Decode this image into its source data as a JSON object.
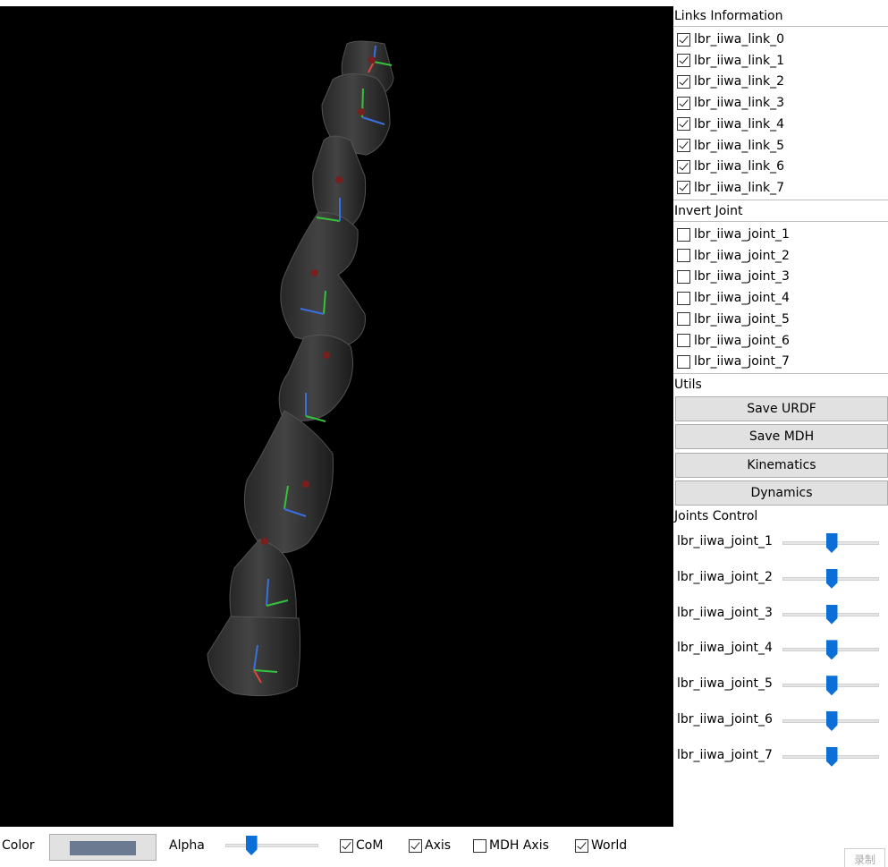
{
  "viewport": {
    "background": "#000000"
  },
  "links_information": {
    "title": "Links Information",
    "items": [
      {
        "label": "lbr_iiwa_link_0",
        "checked": true
      },
      {
        "label": "lbr_iiwa_link_1",
        "checked": true
      },
      {
        "label": "lbr_iiwa_link_2",
        "checked": true
      },
      {
        "label": "lbr_iiwa_link_3",
        "checked": true
      },
      {
        "label": "lbr_iiwa_link_4",
        "checked": true
      },
      {
        "label": "lbr_iiwa_link_5",
        "checked": true
      },
      {
        "label": "lbr_iiwa_link_6",
        "checked": true
      },
      {
        "label": "lbr_iiwa_link_7",
        "checked": true
      }
    ]
  },
  "invert_joint": {
    "title": "Invert Joint",
    "items": [
      {
        "label": "lbr_iiwa_joint_1",
        "checked": false
      },
      {
        "label": "lbr_iiwa_joint_2",
        "checked": false
      },
      {
        "label": "lbr_iiwa_joint_3",
        "checked": false
      },
      {
        "label": "lbr_iiwa_joint_4",
        "checked": false
      },
      {
        "label": "lbr_iiwa_joint_5",
        "checked": false
      },
      {
        "label": "lbr_iiwa_joint_6",
        "checked": false
      },
      {
        "label": "lbr_iiwa_joint_7",
        "checked": false
      }
    ]
  },
  "utils": {
    "title": "Utils",
    "buttons": [
      "Save URDF",
      "Save MDH",
      "Kinematics",
      "Dynamics"
    ]
  },
  "joints_control": {
    "title": "Joints Control",
    "joints": [
      {
        "label": "lbr_iiwa_joint_1",
        "value": 0.5
      },
      {
        "label": "lbr_iiwa_joint_2",
        "value": 0.5
      },
      {
        "label": "lbr_iiwa_joint_3",
        "value": 0.5
      },
      {
        "label": "lbr_iiwa_joint_4",
        "value": 0.5
      },
      {
        "label": "lbr_iiwa_joint_5",
        "value": 0.5
      },
      {
        "label": "lbr_iiwa_joint_6",
        "value": 0.5
      },
      {
        "label": "lbr_iiwa_joint_7",
        "value": 0.5
      }
    ]
  },
  "bottom_bar": {
    "color_label": "Color",
    "color_value": "#6b7a90",
    "alpha_label": "Alpha",
    "alpha_value": 0.27,
    "com": {
      "label": "CoM",
      "checked": true
    },
    "axis": {
      "label": "Axis",
      "checked": true
    },
    "mdh_axis": {
      "label": "MDH Axis",
      "checked": false
    },
    "world": {
      "label": "World",
      "checked": true
    },
    "record_label": "录制"
  },
  "colors": {
    "accent": "#0a6fd6",
    "axis_x": "#e0443a",
    "axis_y": "#35c23b",
    "axis_z": "#3a6fe0",
    "com_marker": "#7a1e1e"
  }
}
